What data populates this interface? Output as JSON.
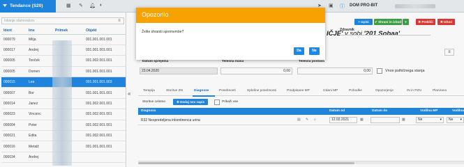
{
  "app": {
    "title": "Tendance (S20)",
    "company": "DOM PRO-BIT"
  },
  "topbar_icons": [
    "grid-icon",
    "edit-icon",
    "bell-icon",
    "theme-icon"
  ],
  "topbar_right_icons": [
    "send-icon",
    "device-icon",
    "info-icon"
  ],
  "left_panel": {
    "filter_placeholder": "Iskanje stanovalcev",
    "filter_button": "≡",
    "columns": [
      "Ident",
      "Ime",
      "Priimek",
      "Objekt"
    ],
    "rows": [
      {
        "id": "000079",
        "name": "Mitja",
        "object": "001.001.001.001",
        "selected": false
      },
      {
        "id": "000017",
        "name": "Andrej",
        "object": "001.001.001.001",
        "selected": false
      },
      {
        "id": "000005",
        "name": "Tonček",
        "object": "001.002.001.001",
        "selected": false
      },
      {
        "id": "000005",
        "name": "Domen",
        "object": "001.001.001.001",
        "selected": false
      },
      {
        "id": "000015",
        "name": "Lea",
        "object": "001.001.001.003",
        "selected": true
      },
      {
        "id": "000007",
        "name": "Bor",
        "object": "001.001.001.001",
        "selected": false
      },
      {
        "id": "000014",
        "name": "Janez",
        "object": "001.002.001.001",
        "selected": false
      },
      {
        "id": "000023",
        "name": "Vincenc",
        "object": "001.002.001.001",
        "selected": false
      },
      {
        "id": "000004",
        "name": "Peter",
        "object": "001.002.001.001",
        "selected": false
      },
      {
        "id": "000021",
        "name": "Edita",
        "object": "001.002.001.001",
        "selected": false
      },
      {
        "id": "000016",
        "name": "Metalž",
        "object": "001.001.001.001",
        "selected": false
      },
      {
        "id": "000034",
        "name": "Andrej",
        "object": "",
        "selected": false
      }
    ],
    "collapse_icon": "«"
  },
  "toolbar": {
    "new_label": "+ Izpisi",
    "save_close_label": "✔ Shrani in izhod",
    "dropdown_label": "▾",
    "cancel_label": "✖ Prekliči",
    "exit_label": "✖ Izhod"
  },
  "header": {
    "title_prefix": "IČJE'",
    "title_middle": " v sobi ",
    "title_room": "'201 Sobaa'",
    "doctor_label": "Zdravnik",
    "menu_icon": "≡"
  },
  "fields": {
    "admission_label": "Datum sprejema",
    "admission_value": "23.04.2020",
    "weight_label": "Telesna masa",
    "weight_value": "0,00",
    "height_label": "Telesna postava",
    "height_value": "0,00",
    "mental_label": "Vnos psihičnega stanja"
  },
  "tabs": [
    {
      "label": "Terapija",
      "active": false
    },
    {
      "label": "Storitve ZN",
      "active": false
    },
    {
      "label": "Diagnoze",
      "active": true
    },
    {
      "label": "Posebnosti",
      "active": false
    },
    {
      "label": "Splošne posebnosti",
      "active": false
    },
    {
      "label": "Predpisane MP",
      "active": false
    },
    {
      "label": "Izdani MP",
      "active": false
    },
    {
      "label": "Pohodke",
      "active": false
    },
    {
      "label": "Opozorjenje",
      "active": false
    },
    {
      "label": "IN in PZN",
      "active": false
    },
    {
      "label": "Planirano",
      "active": false
    }
  ],
  "subbar": {
    "history_label": "Storitve celotno",
    "add_label": "✚ Dodaj nov zapis",
    "show_all_label": "Prikaži vse"
  },
  "grid": {
    "columns": [
      "Diagnoza",
      "Datum od",
      "Datum do",
      "Vodilna MP",
      "Vodilna"
    ],
    "row": {
      "diagnosis": "R32 Nespredeljena inkontinenca urina",
      "date_from": "12.02.2021",
      "date_to": "",
      "lead_mp": "Ne",
      "lead": "Ne"
    }
  },
  "dialog": {
    "title": "Opozorilo",
    "message": "Želite shraniti spremembe?",
    "yes_label": "Da",
    "no_label": "Ne"
  },
  "colors": {
    "accent": "#1e88e5",
    "warning": "#f7a200",
    "success": "#3fa44a",
    "danger": "#e53935"
  }
}
